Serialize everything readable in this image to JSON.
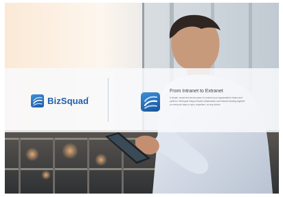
{
  "brand": {
    "name": "BizSquad",
    "trademark": "™",
    "color": "#1f5fa8",
    "logo_icon": "bizsquad-logo-icon"
  },
  "feature": {
    "title": "From Intranet to Extranet",
    "icon": "bizsquad-feature-icon",
    "description": "A simple, smart and secure place to connect your organization's teams and partners. BizSquad brings intranet collaboration and extranet sharing together so everyone stays in sync, anywhere, on any device."
  },
  "colors": {
    "banner": "#f8f9fb",
    "accent": "#1f5fa8",
    "title_text": "#3a4550",
    "body_text": "#6f7b87"
  }
}
